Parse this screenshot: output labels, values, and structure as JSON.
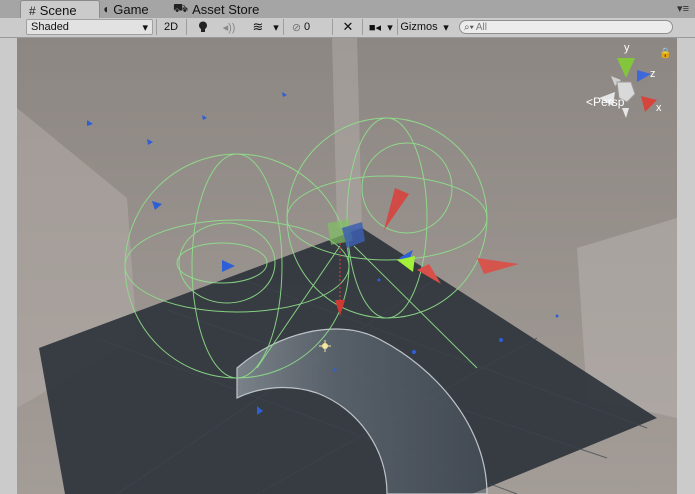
{
  "tabs": [
    {
      "icon": "#",
      "label": "Scene"
    },
    {
      "icon": "◖",
      "label": "Game"
    },
    {
      "icon": "⛟",
      "label": "Asset Store"
    }
  ],
  "tab_menu_icon": "▾≡",
  "toolbar": {
    "draw_mode": "Shaded",
    "two_d": "2D",
    "hidden_count": "0",
    "gizmos": "Gizmos",
    "search_placeholder": "All"
  },
  "gizmo": {
    "y": "y",
    "z": "z",
    "x": "x",
    "projection": "Persp"
  }
}
